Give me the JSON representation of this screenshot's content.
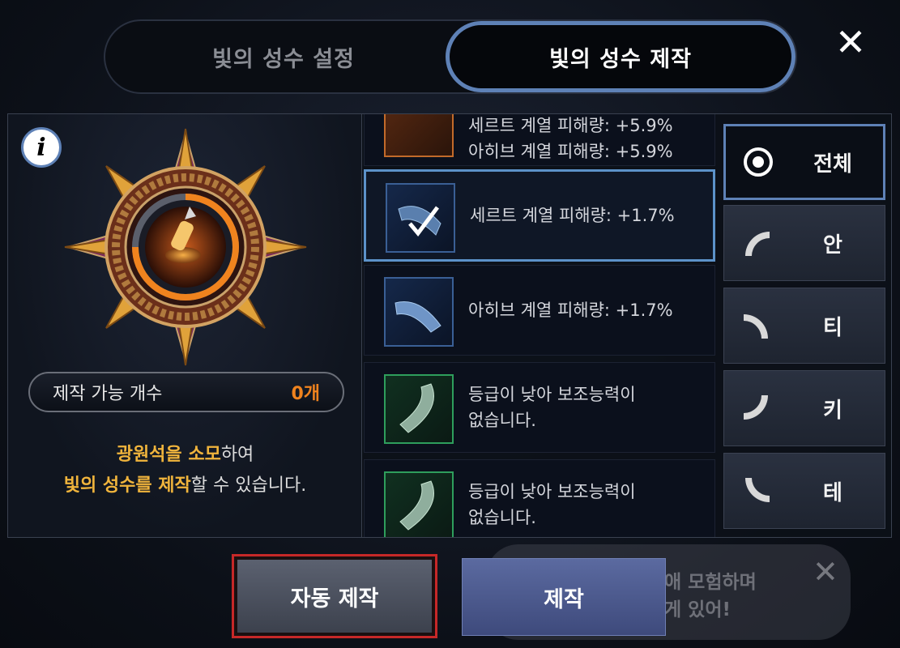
{
  "tabs": [
    {
      "label": "빛의 성수 설정",
      "active": false
    },
    {
      "label": "빛의 성수 제작",
      "active": true
    }
  ],
  "close_icon": "close-icon",
  "left_panel": {
    "info_icon": "i",
    "count_label": "제작 가능 개수",
    "count_value": "0개",
    "desc_line1_highlight": "광원석을 소모",
    "desc_line1_rest": "하여",
    "desc_line2_highlight": "빛의 성수를 제작",
    "desc_line2_rest": "할 수 있습니다."
  },
  "items": [
    {
      "line1": "세르트 계열 피해량: +5.9%",
      "line2": "아히브 계열 피해량: +5.9%",
      "grade": "orange"
    },
    {
      "line1": "세르트 계열 피해량: +1.7%",
      "line2": "",
      "grade": "blue",
      "selected": true
    },
    {
      "line1": "아히브 계열 피해량: +1.7%",
      "line2": "",
      "grade": "blue"
    },
    {
      "line1": "등급이 낮아 보조능력이",
      "line2": "없습니다.",
      "grade": "green"
    },
    {
      "line1": "등급이 낮아 보조능력이",
      "line2": "없습니다.",
      "grade": "green"
    }
  ],
  "filters": [
    {
      "label": "전체",
      "active": true
    },
    {
      "label": "안"
    },
    {
      "label": "티"
    },
    {
      "label": "키"
    },
    {
      "label": "테"
    }
  ],
  "buttons": {
    "auto_craft": "자동 제작",
    "craft": "제작"
  },
  "background_chat": {
    "line1": "애 모험하며",
    "line2": "게 있어!"
  },
  "colors": {
    "accent_blue": "#5e81b6",
    "count_orange": "#f0831e",
    "highlight_gold": "#f0b43c",
    "auto_border_red": "#c62828"
  }
}
